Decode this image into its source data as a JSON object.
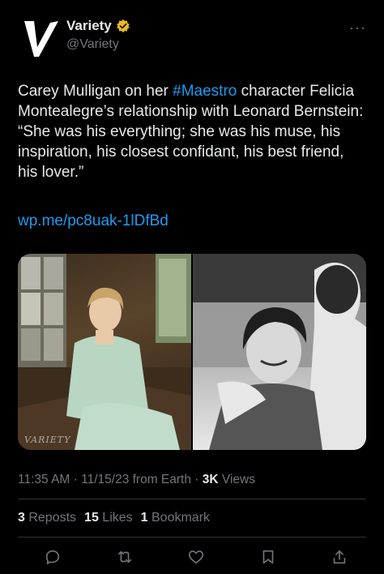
{
  "account": {
    "display_name": "Variety",
    "handle": "@Variety",
    "verified_badge_color": "#e8b923",
    "more_label": "···"
  },
  "tweet": {
    "text_before": "Carey Mulligan on her ",
    "hashtag": "#Maestro",
    "text_after": " character Felicia Montealegre’s relationship with Leonard Bernstein: “She was his everything; she was his muse, his inspiration, his closest confidant, his best friend, his lover.”",
    "link": "wp.me/pc8uak-1lDfBd"
  },
  "media": {
    "watermark": "VARIETY"
  },
  "meta": {
    "time": "11:35 AM",
    "sep1": " · ",
    "date": "11/15/23",
    "source": " from Earth",
    "sep2": " · ",
    "views_count": "3K",
    "views_label": " Views"
  },
  "stats": {
    "reposts_count": "3",
    "reposts_label": " Reposts",
    "likes_count": "15",
    "likes_label": " Likes",
    "bookmarks_count": "1",
    "bookmarks_label": " Bookmark"
  },
  "actions": [
    "reply-icon",
    "repost-icon",
    "like-icon",
    "bookmark-icon",
    "share-icon"
  ],
  "colors": {
    "background": "#000000",
    "text": "#e7e9ea",
    "muted": "#71767b",
    "accent": "#1d9bf0"
  }
}
